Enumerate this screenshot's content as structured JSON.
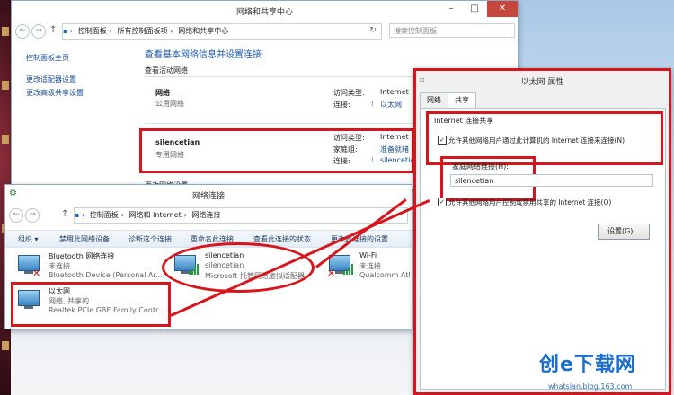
{
  "top_window": {
    "title": "网络和共享中心",
    "address": [
      "控制面板",
      "所有控制面板项",
      "网络和共享中心"
    ],
    "search_placeholder": "搜索控制面板",
    "sidebar": [
      "控制面板主页",
      "更改适配器设置",
      "更改高级共享设置"
    ],
    "heading": "查看基本网络信息并设置连接",
    "active_label": "查看活动网络",
    "net1": {
      "name": "网络",
      "type": "公用网络",
      "access_label": "访问类型:",
      "access_value": "Internet",
      "conn_label": "连接:",
      "conn_value": "以太网"
    },
    "net2": {
      "name": "silencetian",
      "type": "专用网络",
      "access_label": "访问类型:",
      "access_value": "Internet",
      "home_label": "家庭组:",
      "home_value": "准备就绪",
      "conn_label": "连接:",
      "conn_value": "silencetia"
    },
    "partial": "更改网络设置"
  },
  "conn_window": {
    "title": "网络连接",
    "address": [
      "控制面板",
      "网络和 Internet",
      "网络连接"
    ],
    "toolbar": [
      "组织 ▾",
      "禁用此网络设备",
      "诊断这个连接",
      "重命名此连接",
      "查看此连接的状态",
      "更改此连接的设置"
    ],
    "adapters": [
      {
        "name": "Bluetooth 网络连接",
        "status": "未连接",
        "device": "Bluetooth Device (Personal Ar..."
      },
      {
        "name": "silencetian",
        "status": "silencetian",
        "device": "Microsoft 托管网络虚拟适配器"
      },
      {
        "name": "Wi-Fi",
        "status": "未连接",
        "device": "Qualcomm Ath"
      },
      {
        "name": "以太网",
        "status": "网络, 共享的",
        "device": "Realtek PCIe GBE Family Contr..."
      }
    ]
  },
  "dialog": {
    "title": "以太网 属性",
    "tabs": [
      "网络",
      "共享"
    ],
    "group": "Internet 连接共享",
    "allow_share": "允许其他网络用户通过此计算机的 Internet 连接来连接(N)",
    "home_label": "家庭网络连接(H):",
    "home_value": "silencetian",
    "allow_control": "允许其他网络用户控制或禁用共享的 Internet 连接(O)",
    "settings_button": "设置(G)..."
  },
  "watermark": {
    "logo": "创e下载网",
    "site": "whatsian.blog.163.com"
  }
}
